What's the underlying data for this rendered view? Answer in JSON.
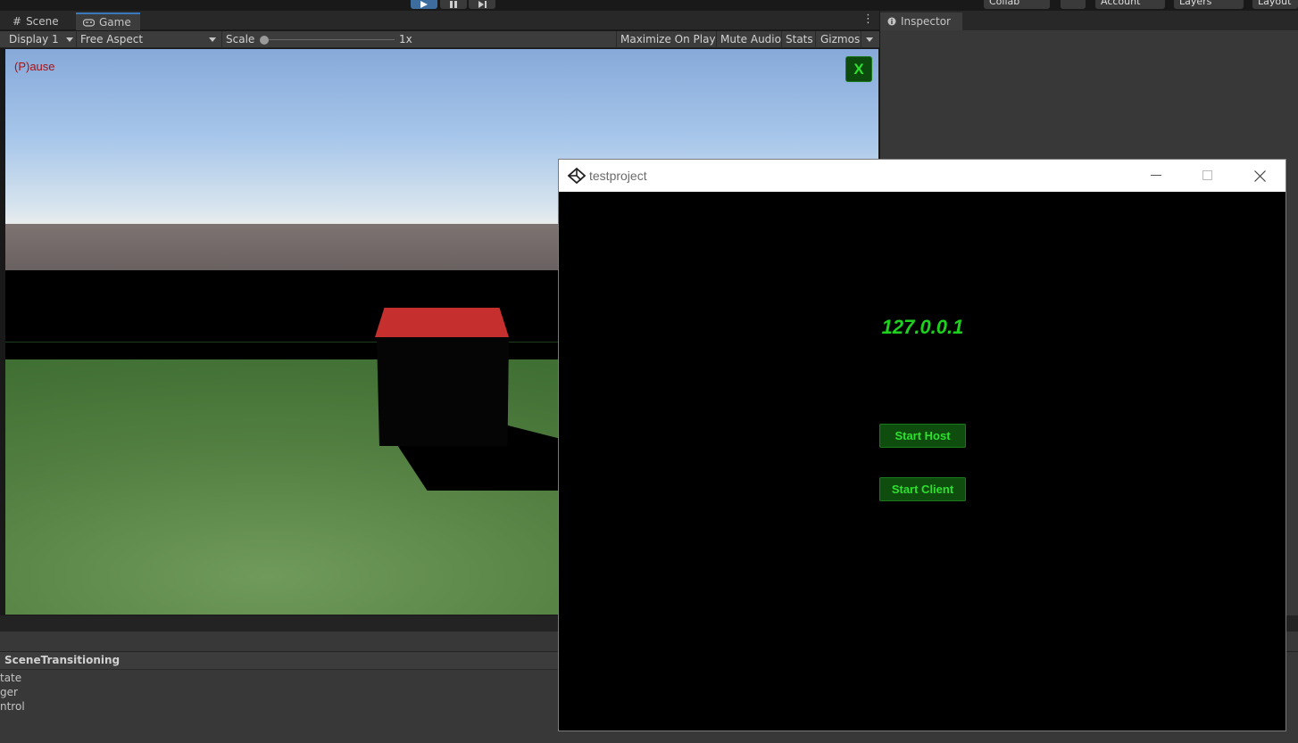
{
  "toolbar": {
    "collab_label": "Collab",
    "account_label": "Account",
    "layers_label": "Layers",
    "layout_label": "Layout"
  },
  "game_panel": {
    "tabs": [
      {
        "label": "Scene",
        "icon": "grid-icon"
      },
      {
        "label": "Game",
        "icon": "gamepad-icon"
      }
    ],
    "display_label": "Display 1",
    "aspect_label": "Free Aspect",
    "scale_label": "Scale",
    "scale_value": "1x",
    "maximize_label": "Maximize On Play",
    "mute_label": "Mute Audio",
    "stats_label": "Stats",
    "gizmos_label": "Gizmos",
    "pause_text": "(P)ause",
    "close_button_label": "X"
  },
  "inspector": {
    "tab_label": "Inspector",
    "icon": "info-icon"
  },
  "animator": {
    "title": "SceneTransitioning",
    "items": [
      "tate",
      "ger",
      "ntrol"
    ]
  },
  "app_window": {
    "title": "testproject",
    "ip_address": "127.0.0.1",
    "start_host_label": "Start Host",
    "start_client_label": "Start Client"
  },
  "colors": {
    "accent_green": "#2fe02f",
    "button_green": "#0e4d0e",
    "pause_red": "#aa1111",
    "cube_top": "#c5302f"
  }
}
